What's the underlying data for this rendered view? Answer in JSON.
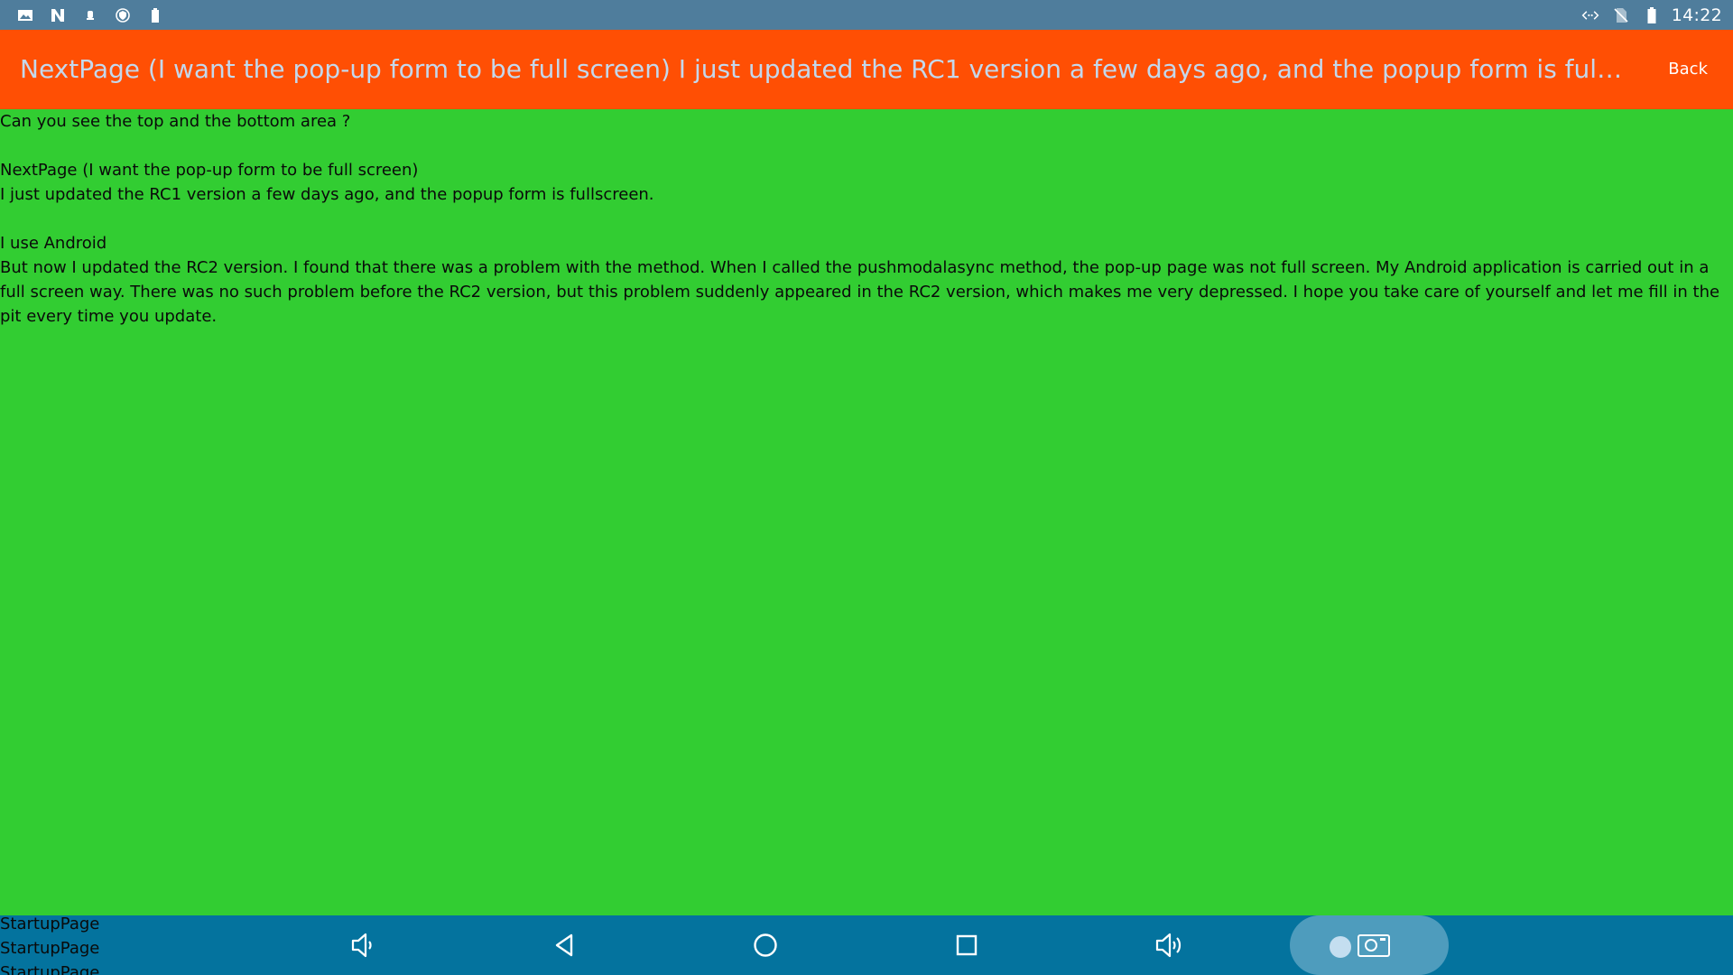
{
  "status_bar": {
    "left_icons": [
      "image-icon",
      "n-logo-icon",
      "notification-icon",
      "shield-icon",
      "battery-saver-icon"
    ],
    "right_icons": [
      "data-transfer-icon",
      "no-sim-icon",
      "battery-icon"
    ],
    "time": "14:22"
  },
  "title_bar": {
    "title": "NextPage (I want the pop-up form to be full screen) I just updated the RC1 version a few days ago, and the popup form is fullscreen.   I use A...",
    "back_label": "Back"
  },
  "content": {
    "body": "Can you see the top and the bottom area ?\n\nNextPage (I want the pop-up form to be full screen)\nI just updated the RC1 version a few days ago, and the popup form is fullscreen.\n\nI use Android\nBut now I updated the RC2 version. I found that there was a problem with the method. When I called the pushmodalasync method, the pop-up page was not full screen. My Android application is carried out in a full screen way. There was no such problem before the RC2 version, but this problem suddenly appeared in the RC2 version, which makes me very depressed. I hope you take care of yourself and let me fill in the pit every time you update."
  },
  "startup_labels": [
    "StartupPage",
    "StartupPage",
    "StartupPage"
  ],
  "nav_bar": {
    "icons": [
      "volume-down-icon",
      "back-triangle-icon",
      "home-circle-icon",
      "recents-square-icon",
      "volume-up-icon",
      "screenshot-camera-icon"
    ]
  },
  "colors": {
    "status_bar": "#4F7D9C",
    "title_bar": "#FF4F04",
    "title_text": "#C4D8EC",
    "content_bg": "#32CD32",
    "nav_bar": "#04739E"
  }
}
